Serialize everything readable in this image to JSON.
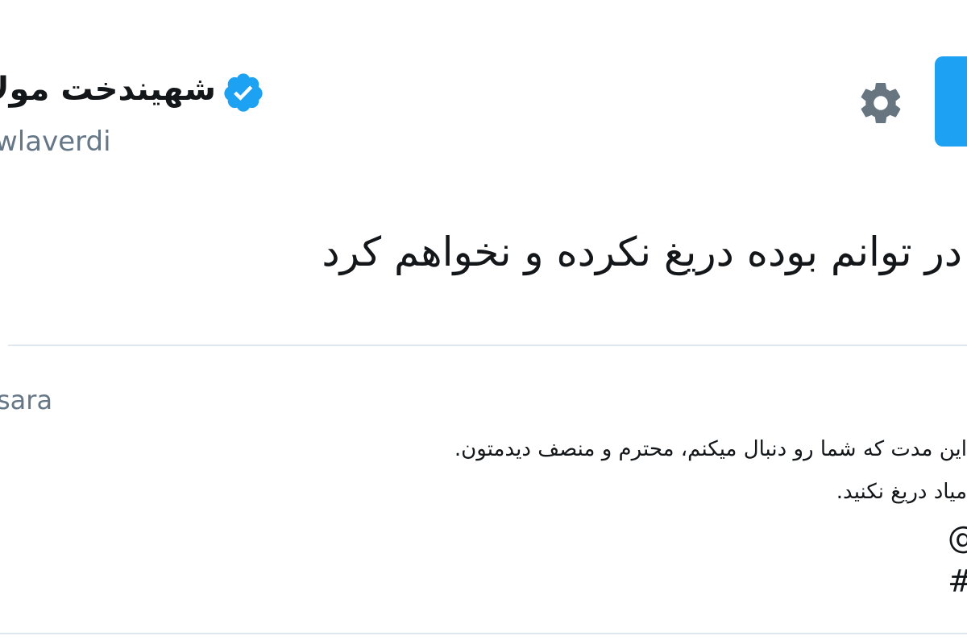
{
  "profile": {
    "display_name": "شهیندخت مولا",
    "handle": "wlaverdi",
    "verified": true
  },
  "icons": {
    "verified": "verified-badge-icon",
    "settings": "gear-icon"
  },
  "colors": {
    "accent": "#1da1f2",
    "text": "#14171a",
    "muted": "#657786",
    "divider": "#e1e8ed"
  },
  "tweet": {
    "text": "در توانم بوده دریغ نکرده و نخواهم کرد"
  },
  "reply": {
    "handle": "sara",
    "line_1": "این مدت که شما رو دنبال میکنم، محترم و منصف دیدمتون.",
    "line_2": "میاد دریغ نکنید.",
    "mention": "@",
    "hashtag": "#"
  }
}
